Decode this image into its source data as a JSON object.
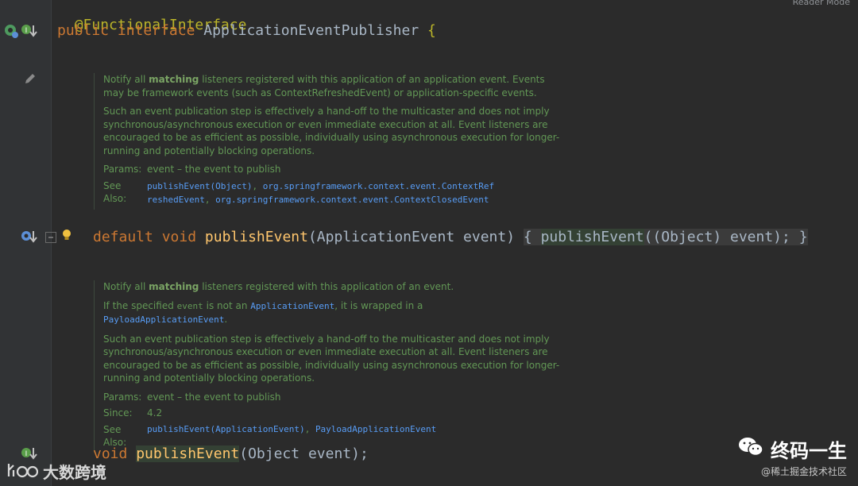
{
  "editor": {
    "reader_mode": "Reader Mode",
    "annotation": "@FunctionalInterface",
    "iface_kw1": "public",
    "iface_kw2": "interface",
    "iface_name": "ApplicationEventPublisher",
    "iface_brace": "{",
    "m1": {
      "kw1": "default",
      "kw2": "void",
      "name": "publishEvent",
      "params": "(ApplicationEvent event)",
      "body_open": "{",
      "call": "publishEvent",
      "args": "((Object) event);",
      "body_close": "}"
    },
    "m2": {
      "kw": "void",
      "name": "publishEvent",
      "params": "(Object event);"
    }
  },
  "doc1": {
    "p1_pre": "Notify all",
    "p1_bold": "matching",
    "p1_post": "listeners registered with this application of an application event. Events may be framework events (such as ContextRefreshedEvent) or application-specific events.",
    "p2": "Such an event publication step is effectively a hand-off to the multicaster and does not imply synchronous/asynchronous execution or even immediate execution at all. Event listeners are encouraged to be as efficient as possible, individually using asynchronous execution for longer-running and potentially blocking operations.",
    "params_label": "Params:",
    "params_value": "event – the event to publish",
    "see_label": "See Also:",
    "see_link1": "publishEvent(Object)",
    "see_sep1": ",",
    "see_link2": "org.springframework.context.event.ContextRefreshedEvent",
    "see_sep2": ",",
    "see_link3": "org.springframework.context.event.ContextClosedEvent"
  },
  "doc2": {
    "p1_pre": "Notify all",
    "p1_bold": "matching",
    "p1_post": "listeners registered with this application of an event.",
    "p2_pre": "If the specified",
    "p2_code": "event",
    "p2_mid": "is not an",
    "p2_link": "ApplicationEvent",
    "p2_post": ", it is wrapped in a",
    "p2_link2": "PayloadApplicationEvent",
    "p2_end": ".",
    "p3": "Such an event publication step is effectively a hand-off to the multicaster and does not imply synchronous/asynchronous execution or even immediate execution at all. Event listeners are encouraged to be as efficient as possible, individually using asynchronous execution for longer-running and potentially blocking operations.",
    "params_label": "Params:",
    "params_value": "event – the event to publish",
    "since_label": "Since:",
    "since_value": "4.2",
    "see_label": "See Also:",
    "see_link1": "publishEvent(ApplicationEvent)",
    "see_sep1": ",",
    "see_link2": "PayloadApplicationEvent"
  },
  "watermarks": {
    "left_text": "大数跨境",
    "right_title": "终码一生",
    "right_sub": "@稀土掘金技术社区"
  },
  "colors": {
    "background": "#2b2b2b",
    "keyword": "#cc7832",
    "annotation": "#bbb529",
    "method": "#ffc66d",
    "doc_text": "#629755",
    "doc_link": "#589df6"
  }
}
